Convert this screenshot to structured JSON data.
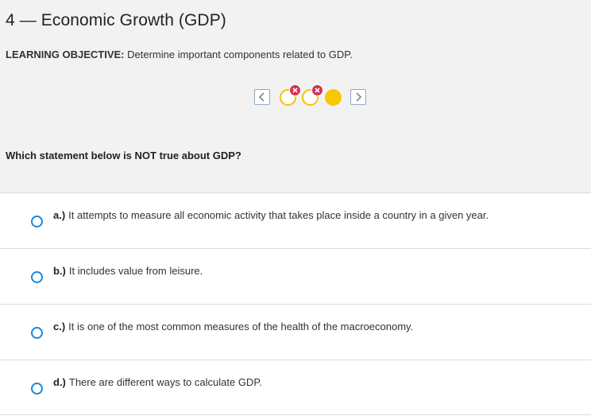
{
  "header": {
    "title": "4 — Economic Growth (GDP)",
    "objective_label": "LEARNING OBJECTIVE:",
    "objective_text": " Determine important components related to GDP."
  },
  "progress": {
    "prev_icon": "chevron-left-icon",
    "next_icon": "chevron-right-icon",
    "dots": [
      {
        "state": "incorrect",
        "icon": "x-icon"
      },
      {
        "state": "incorrect",
        "icon": "x-icon"
      },
      {
        "state": "current"
      }
    ],
    "colors": {
      "dot": "#f7c800",
      "wrong": "#d9304f",
      "nav_border": "#8fa6c2"
    }
  },
  "question": {
    "text": "Which statement below is NOT true about GDP?"
  },
  "options": [
    {
      "letter": "a.)",
      "text": "It attempts to measure all economic activity that takes place inside a country in a given year."
    },
    {
      "letter": "b.)",
      "text": "It includes value from leisure."
    },
    {
      "letter": "c.)",
      "text": "It is one of the most common measures of the health of the macroeconomy."
    },
    {
      "letter": "d.)",
      "text": "There are different ways to calculate GDP."
    }
  ],
  "accent_color": "#1a87d8"
}
